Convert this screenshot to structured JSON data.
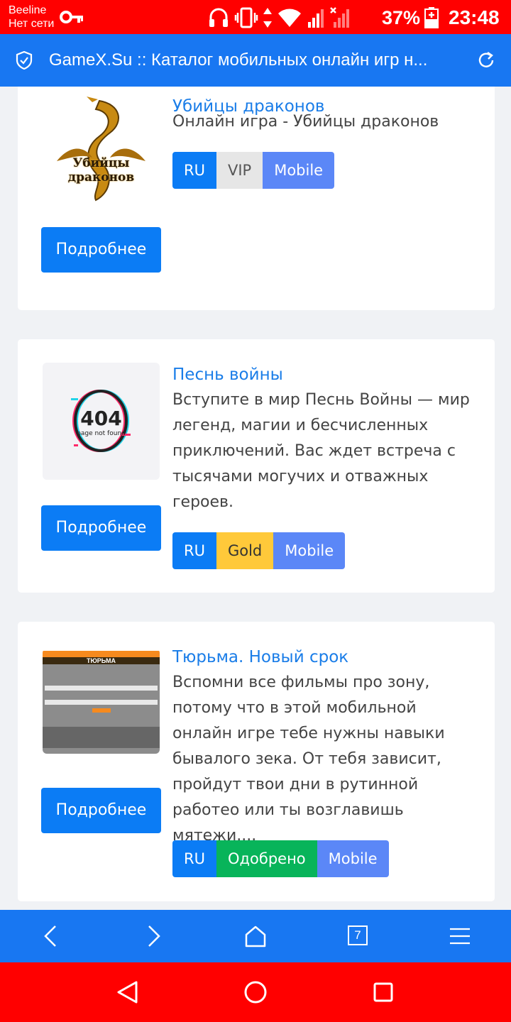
{
  "status_bar": {
    "carrier": "Beeline",
    "carrier_status": "Нет сети",
    "battery": "37%",
    "time": "23:48",
    "icons": [
      "key-icon",
      "headphones-icon",
      "vibrate-icon",
      "data-arrows-icon",
      "wifi-icon",
      "signal-icon",
      "no-signal-icon",
      "battery-charging-icon"
    ]
  },
  "browser_bar": {
    "title": "GameX.Su :: Каталог мобильных онлайн игр н...",
    "icons": [
      "shield-icon",
      "reload-icon"
    ]
  },
  "cards": [
    {
      "title": "Убийцы драконов",
      "description": "Онлайн игра - Убийцы драконов",
      "image_text": "Убийцы драконов",
      "more_label": "Подробнее",
      "badges": [
        {
          "label": "RU",
          "kind": "ru"
        },
        {
          "label": "VIP",
          "kind": "vip"
        },
        {
          "label": "Mobile",
          "kind": "mobile"
        }
      ]
    },
    {
      "title": "Песнь войны",
      "description": "Вступите в мир Песнь Войны — мир легенд, магии и бесчисленных приключений. Вас ждет встреча с тысячами могучих и отважных героев.",
      "image_text": "404",
      "image_subtext": "page not found",
      "more_label": "Подробнее",
      "badges": [
        {
          "label": "RU",
          "kind": "ru"
        },
        {
          "label": "Gold",
          "kind": "gold"
        },
        {
          "label": "Mobile",
          "kind": "mobile"
        }
      ]
    },
    {
      "title": "Тюрьма. Новый срок",
      "description": "Вспомни все фильмы про зону, потому что в этой мобильной онлайн игре тебе нужны навыки бывалого зека. От тебя зависит, пройдут твои дни в рутинной работео или ты возглавишь мятежи....",
      "image_text": "ТЮРЬМА",
      "more_label": "Подробнее",
      "badges": [
        {
          "label": "RU",
          "kind": "ru"
        },
        {
          "label": "Одобрено",
          "kind": "approved"
        },
        {
          "label": "Mobile",
          "kind": "mobile"
        }
      ]
    }
  ],
  "browser_nav": {
    "tab_count": "7",
    "icons": [
      "back-icon",
      "forward-icon",
      "home-icon",
      "tabs-icon",
      "menu-icon"
    ]
  },
  "android_nav": {
    "icons": [
      "back-triangle-icon",
      "home-circle-icon",
      "recents-square-icon"
    ]
  },
  "colors": {
    "status_bar": "#ff0000",
    "browser_bar": "#1877f2",
    "link": "#1a7de8",
    "ru_badge": "#0b7cf5",
    "mobile_badge": "#5b87f7",
    "gold_badge": "#ffc93a",
    "approved_badge": "#08b45a"
  }
}
